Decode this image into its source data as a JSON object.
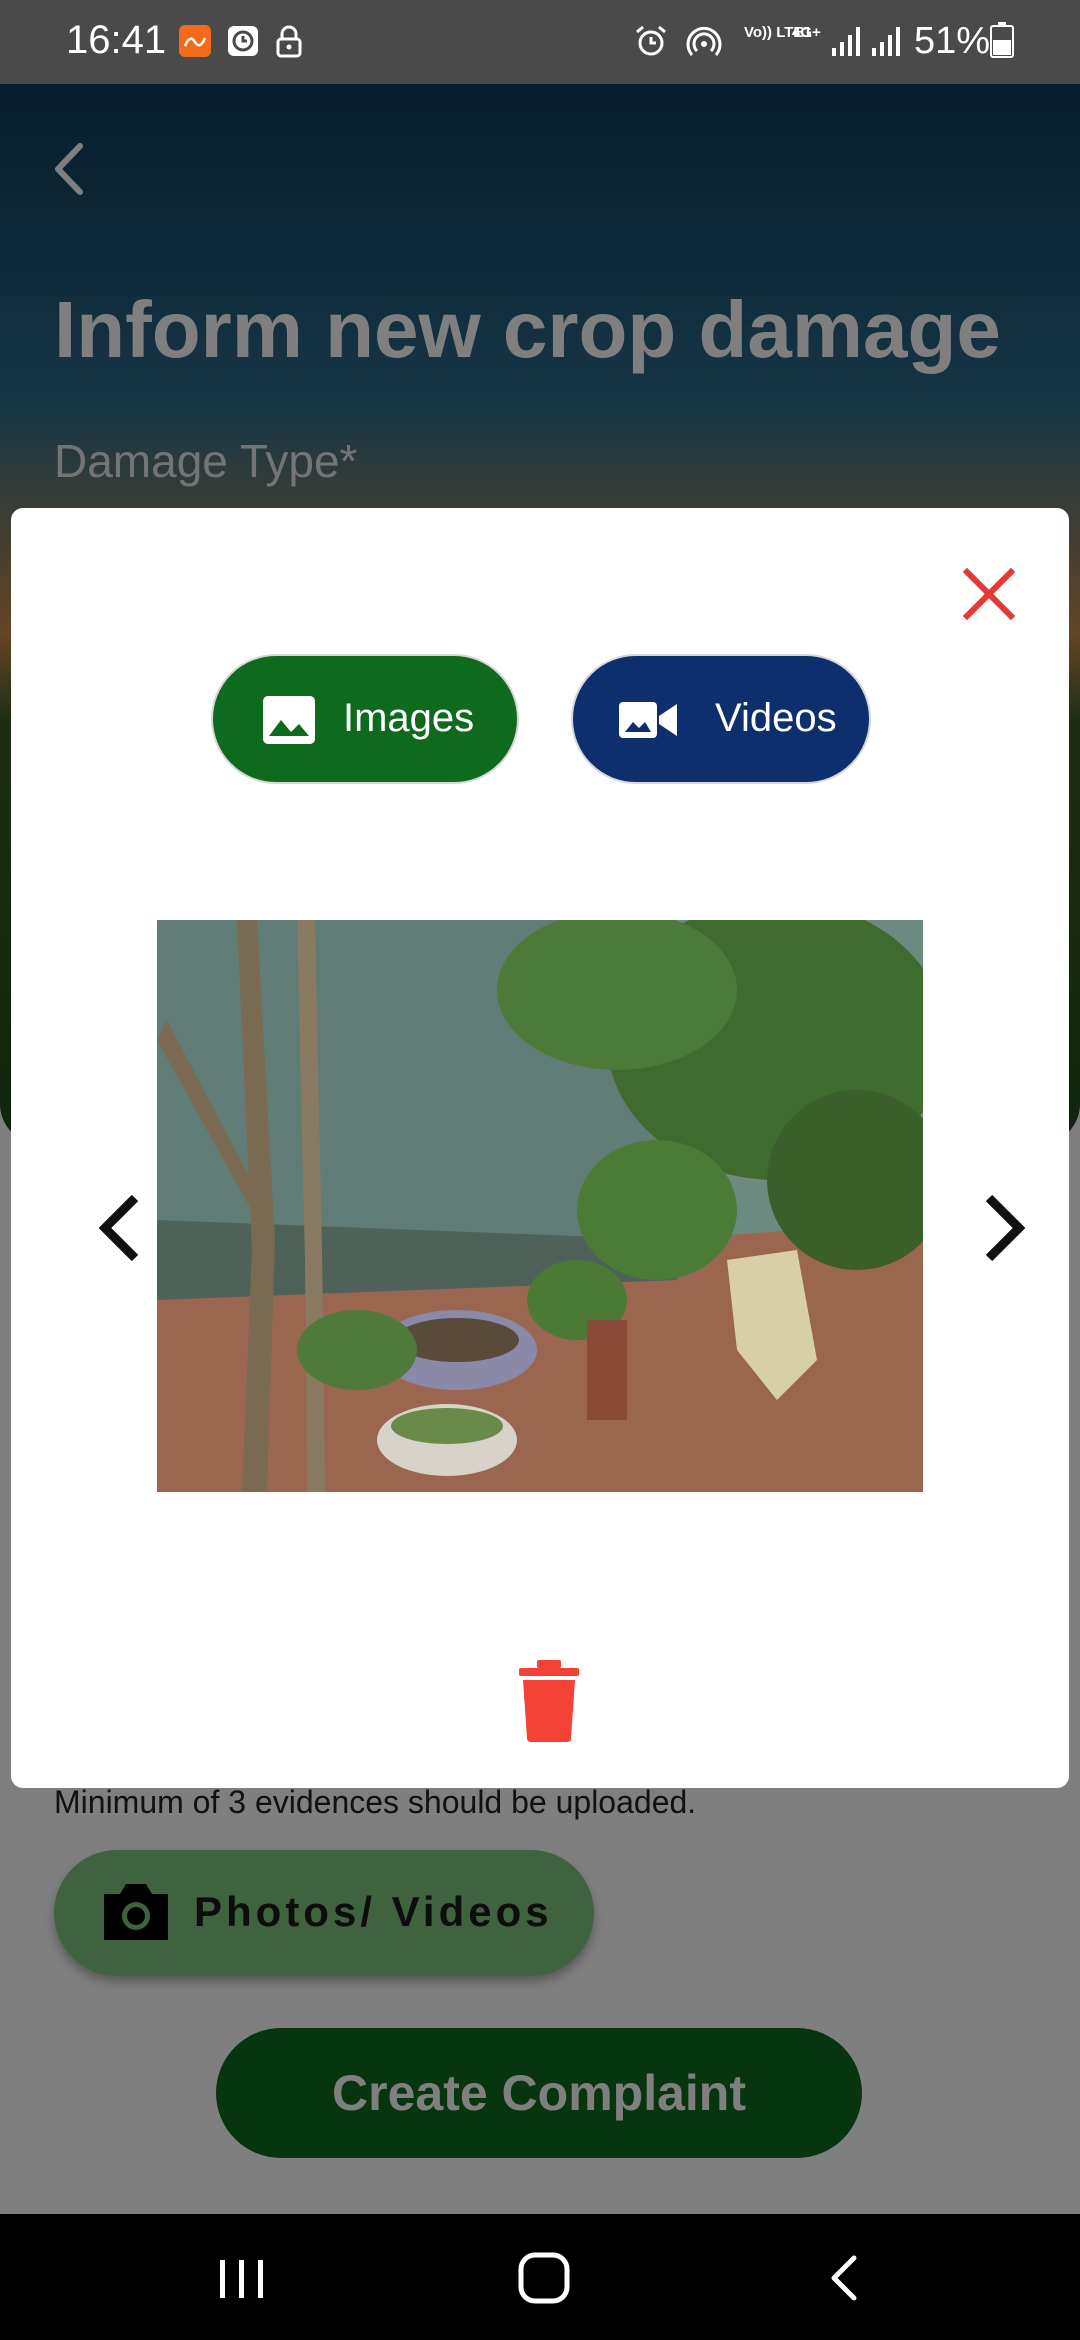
{
  "status_bar": {
    "time": "16:41",
    "network_label": "Vo)) LTE1",
    "network_type": "4G+",
    "battery_percent": "51%",
    "icons": [
      "app-notification-icon",
      "clock-app-icon",
      "lock-icon",
      "alarm-icon",
      "hotspot-icon",
      "signal-icon",
      "signal-icon",
      "battery-icon"
    ]
  },
  "app": {
    "title": "Inform new crop damage",
    "damage_type_label": "Damage Type*",
    "evidence_note": "Minimum of 3 evidences should be uploaded.",
    "photos_button_label": "Photos/ Videos",
    "create_button_label": "Create Complaint"
  },
  "modal": {
    "images_tab_label": "Images",
    "videos_tab_label": "Videos",
    "images_tab_color": "#0e6b1e",
    "videos_tab_color": "#0d2f6e",
    "close_color": "#e53935",
    "delete_color": "#f44336"
  },
  "nav_bar": {
    "icons": [
      "recents-icon",
      "home-icon",
      "back-icon"
    ]
  }
}
